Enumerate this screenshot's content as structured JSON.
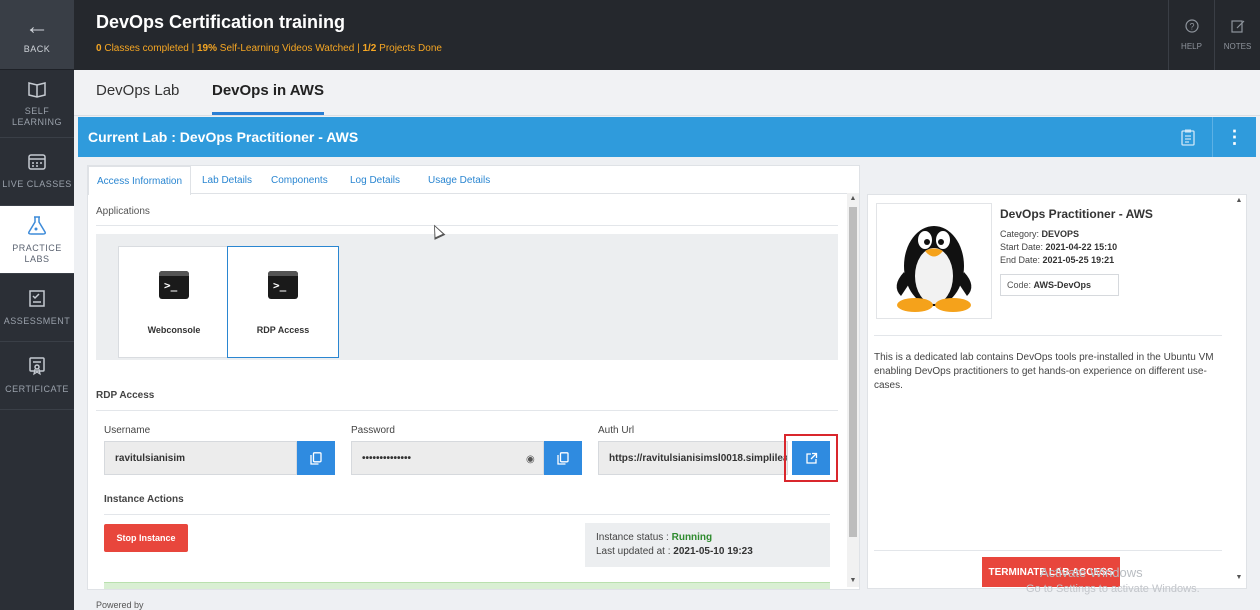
{
  "sidebar": {
    "back": "BACK",
    "items": [
      {
        "label": "SELF LEARNING",
        "icon": "book-icon"
      },
      {
        "label": "LIVE CLASSES",
        "icon": "calendar-icon"
      },
      {
        "label": "PRACTICE LABS",
        "icon": "flask-icon"
      },
      {
        "label": "ASSESSMENT",
        "icon": "checklist-icon"
      },
      {
        "label": "CERTIFICATE",
        "icon": "certificate-icon"
      }
    ]
  },
  "header": {
    "title": "DevOps Certification training",
    "classes_completed": "0",
    "classes_text": " Classes completed | ",
    "videos_pct": "19%",
    "videos_text": " Self-Learning Videos Watched  | ",
    "projects": "1/2",
    "projects_text": " Projects Done",
    "help": "HELP",
    "notes": "NOTES"
  },
  "tabs": [
    "DevOps Lab",
    "DevOps in AWS"
  ],
  "lab": {
    "current_label": "Current Lab : DevOps Practitioner - AWS"
  },
  "sub_tabs": [
    "Access Information",
    "Lab Details",
    "Components",
    "Log Details",
    "Usage Details"
  ],
  "applications": {
    "heading": "Applications",
    "items": [
      "Webconsole",
      "RDP Access"
    ]
  },
  "rdp": {
    "heading": "RDP Access",
    "username_label": "Username",
    "username_value": "ravitulsianisim",
    "password_label": "Password",
    "password_value": "••••••••••••••",
    "auth_label": "Auth Url",
    "auth_value": "https://ravitulsianisimsl0018.simplilearn"
  },
  "instance": {
    "heading": "Instance Actions",
    "stop_label": "Stop Instance",
    "status_label": "Instance status : ",
    "status_value": "Running",
    "updated_label": "Last updated at : ",
    "updated_value": "2021-05-10 19:23"
  },
  "details": {
    "name": "DevOps Practitioner - AWS",
    "category_label": "Category: ",
    "category_value": "DEVOPS",
    "start_label": "Start Date: ",
    "start_value": "2021-04-22 15:10",
    "end_label": "End Date: ",
    "end_value": "2021-05-25 19:21",
    "code_label": "Code: ",
    "code_value": "AWS-DevOps",
    "description": "This is a dedicated lab contains DevOps tools pre-installed in the Ubuntu VM enabling DevOps practitioners to get hands-on experience on different use-cases.",
    "terminate_label": "TERMINATE LAB ACCESS"
  },
  "footer": {
    "powered": "Powered by",
    "watermark_title": "Activate Windows",
    "watermark_sub": "Go to Settings to activate Windows."
  }
}
